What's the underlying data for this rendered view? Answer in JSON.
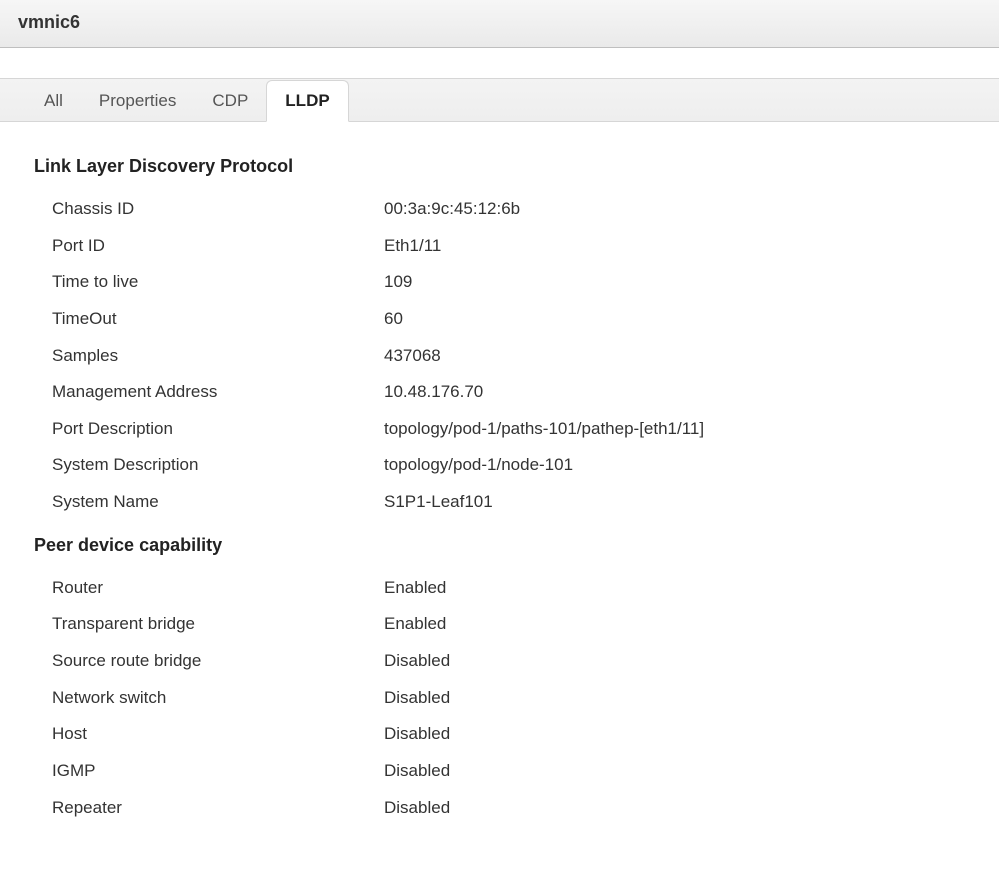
{
  "header": {
    "title": "vmnic6"
  },
  "tabs": [
    {
      "label": "All",
      "active": false
    },
    {
      "label": "Properties",
      "active": false
    },
    {
      "label": "CDP",
      "active": false
    },
    {
      "label": "LLDP",
      "active": true
    }
  ],
  "sections": {
    "lldp": {
      "heading": "Link Layer Discovery Protocol",
      "rows": [
        {
          "label": "Chassis ID",
          "value": "00:3a:9c:45:12:6b"
        },
        {
          "label": "Port ID",
          "value": "Eth1/11"
        },
        {
          "label": "Time to live",
          "value": "109"
        },
        {
          "label": "TimeOut",
          "value": "60"
        },
        {
          "label": "Samples",
          "value": "437068"
        },
        {
          "label": "Management Address",
          "value": "10.48.176.70"
        },
        {
          "label": "Port Description",
          "value": "topology/pod-1/paths-101/pathep-[eth1/11]"
        },
        {
          "label": "System Description",
          "value": "topology/pod-1/node-101"
        },
        {
          "label": "System Name",
          "value": "S1P1-Leaf101"
        }
      ]
    },
    "capability": {
      "heading": "Peer device capability",
      "rows": [
        {
          "label": "Router",
          "value": "Enabled"
        },
        {
          "label": "Transparent bridge",
          "value": "Enabled"
        },
        {
          "label": "Source route bridge",
          "value": "Disabled"
        },
        {
          "label": "Network switch",
          "value": "Disabled"
        },
        {
          "label": "Host",
          "value": "Disabled"
        },
        {
          "label": "IGMP",
          "value": "Disabled"
        },
        {
          "label": "Repeater",
          "value": "Disabled"
        }
      ]
    }
  }
}
